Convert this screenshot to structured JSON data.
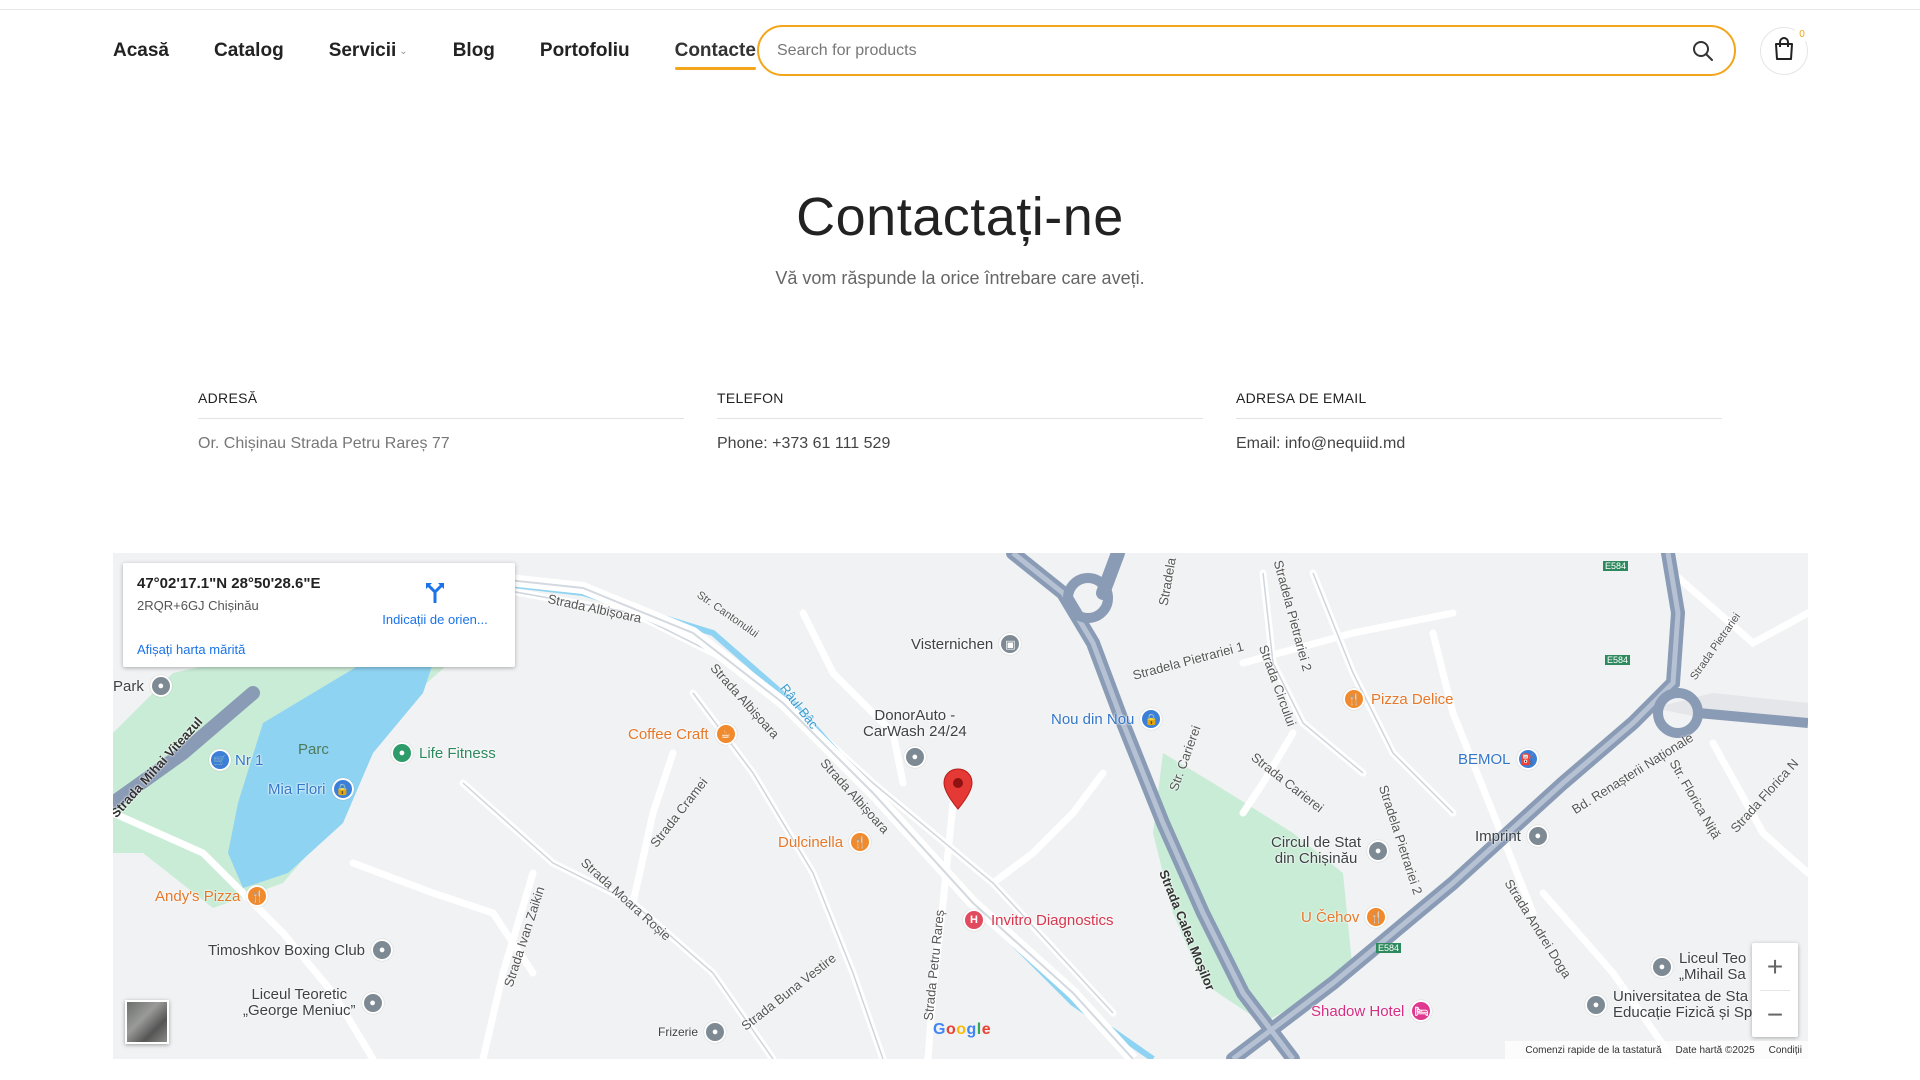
{
  "nav": {
    "items": [
      {
        "label": "Acasă"
      },
      {
        "label": "Catalog"
      },
      {
        "label": "Servicii"
      },
      {
        "label": "Blog"
      },
      {
        "label": "Portofoliu"
      },
      {
        "label": "Contacte"
      }
    ],
    "active": "Contacte"
  },
  "search": {
    "placeholder": "Search for products"
  },
  "cart": {
    "count": "0"
  },
  "hero": {
    "title": "Contactați-ne",
    "subtitle": "Vă vom răspunde la orice întrebare care aveți."
  },
  "info": {
    "address": {
      "label": "ADRESĂ",
      "value": "Or. Chișinau Strada Petru Rareș 77"
    },
    "phone": {
      "label": "TELEFON",
      "value": "Phone: +373 61 111 529"
    },
    "email": {
      "label": "ADRESA DE EMAIL",
      "value": "Email: info@nequiid.md"
    }
  },
  "map": {
    "infobox": {
      "coords": "47°02'17.1\"N 28°50'28.6\"E",
      "plus_code": "2RQR+6GJ Chișinău",
      "larger_map": "Afișați harta mărită",
      "directions": "Indicații de orien..."
    },
    "pois": {
      "visternichen": "Visternichen",
      "donorauto": "DonorAuto -",
      "donorauto2": "CarWash 24/24",
      "coffee": "Coffee Craft",
      "dulcinella": "Dulcinella",
      "invitro": "Invitro Diagnostics",
      "nou": "Nou din Nou",
      "pizza_delice": "Pizza Delice",
      "bemol": "BEMOL",
      "imprint": "Imprint",
      "circul": "Circul de Stat",
      "circul2": "din Chișinău",
      "ucehov": "U Čehov",
      "shadow": "Shadow Hotel",
      "liceul_teo": "Liceul Teo",
      "liceul_teo2": "„Mihail Sa",
      "univ": "Universitatea de Sta",
      "univ2": "Educație Fizică și Sp",
      "park": "Park",
      "nr1": "Nr 1",
      "parc": "Parc",
      "life": "Life Fitness",
      "mia": "Mia Flori",
      "andys": "Andy's Pizza",
      "timoshkov": "Timoshkov Boxing Club",
      "liceul_g": "Liceul Teoretic",
      "liceul_g2": "„George Meniuc”",
      "frizerie": "Frizerie"
    },
    "streets": {
      "albisoara1": "Strada Albișoara",
      "albisoara2": "Strada Albișoara",
      "albisoara3": "Strada Albișoara",
      "cantonului": "Str. Cantonului",
      "raul": "Râul Bâc",
      "cramei": "Strada Cramei",
      "moara": "Strada Moara Roșie",
      "ivan": "Strada Ivan Zaikin",
      "buna": "Strada Buna Vestire",
      "petru": "Strada Petru Rareș",
      "calea": "Strada Calea Moșilor",
      "mihai": "Strada Mihai Viteazul",
      "pietrariei1": "Stradela Pietrariei 1",
      "pietrariei2": "Stradela Pietrariei 2",
      "circului": "Strada Circului",
      "carierei": "Strada Carierei",
      "carierei2": "Str. Carierei",
      "pietrariei3": "Stradela Pietrariei 2",
      "renasterii": "Bd. Renașterii Naționale",
      "florica": "Str. Florica Niță",
      "florica2": "Strada Florica N",
      "andrei": "Strada Andrei Doga",
      "stradela": "Stradela",
      "pietrariei_top": "Strada Pietrariei",
      "e584a": "E584",
      "e584b": "E584",
      "e584c": "E584"
    },
    "google": "Google",
    "footer": {
      "shortcuts": "Comenzi rapide de la tastatură",
      "data": "Date hartă ©2025",
      "terms": "Condiții"
    },
    "zoom_in": "+",
    "zoom_out": "−"
  }
}
